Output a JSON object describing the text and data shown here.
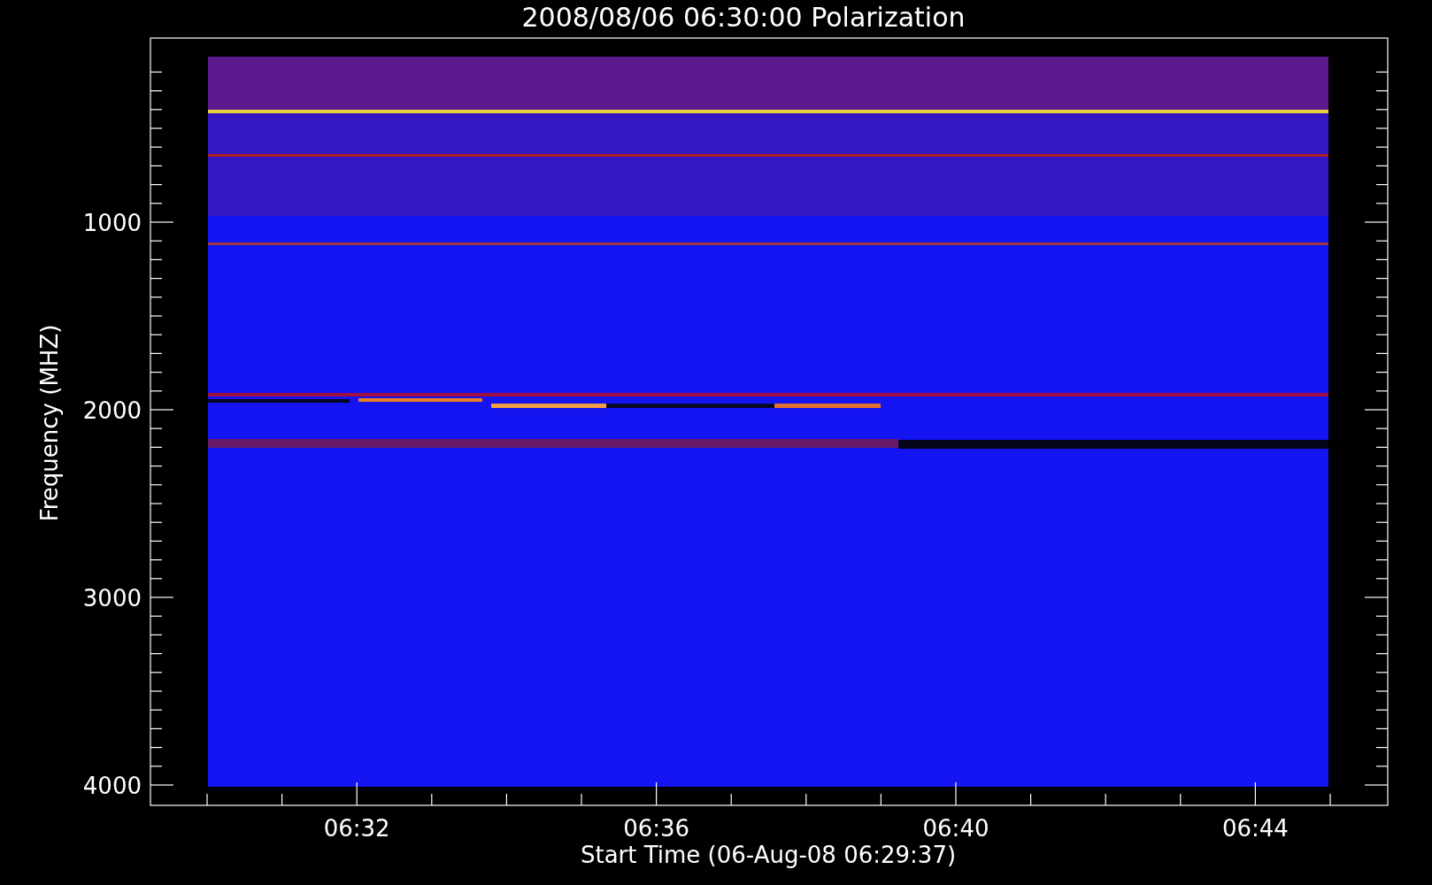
{
  "title": "2008/08/06 06:30:00 Polarization",
  "y_axis": {
    "label": "Frequency (MHZ)",
    "ticks": [
      "1000",
      "2000",
      "3000",
      "4000"
    ]
  },
  "x_axis": {
    "label": "Start Time (06-Aug-08 06:29:37)",
    "ticks": [
      "06:32",
      "06:36",
      "06:40",
      "06:44"
    ]
  }
}
